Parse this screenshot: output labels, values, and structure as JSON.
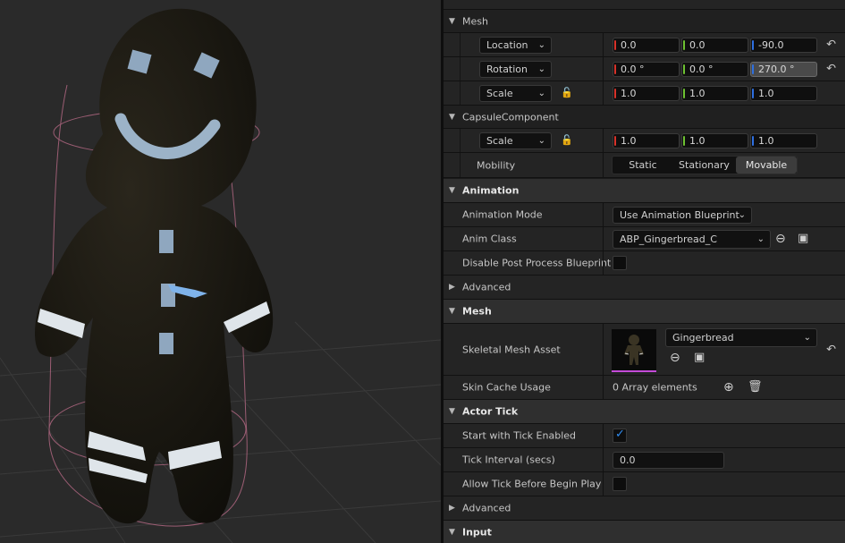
{
  "colors": {
    "x_axis": "#d8322a",
    "y_axis": "#6ec231",
    "z_axis": "#2d6fe0",
    "accent_checkbox": "#2f8cf0",
    "thumb_underline": "#c44bd8"
  },
  "details": {
    "mesh_group": "Mesh",
    "location": {
      "label": "Location",
      "x": "0.0",
      "y": "0.0",
      "z": "-90.0"
    },
    "rotation": {
      "label": "Rotation",
      "x": "0.0 °",
      "y": "0.0 °",
      "z": "270.0 °"
    },
    "scale": {
      "label": "Scale",
      "x": "1.0",
      "y": "1.0",
      "z": "1.0"
    },
    "capsule_group": "CapsuleComponent",
    "capsule_scale": {
      "label": "Scale",
      "x": "1.0",
      "y": "1.0",
      "z": "1.0"
    },
    "mobility": {
      "label": "Mobility",
      "options": [
        "Static",
        "Stationary",
        "Movable"
      ],
      "selected": "Movable"
    }
  },
  "animation": {
    "title": "Animation",
    "mode_label": "Animation Mode",
    "mode_value": "Use Animation Blueprint",
    "class_label": "Anim Class",
    "class_value": "ABP_Gingerbread_C",
    "disable_pp_label": "Disable Post Process Blueprint",
    "disable_pp_checked": false,
    "advanced_label": "Advanced"
  },
  "mesh_section": {
    "title": "Mesh",
    "asset_label": "Skeletal Mesh Asset",
    "asset_value": "Gingerbread",
    "skin_cache_label": "Skin Cache Usage",
    "skin_cache_value": "0 Array elements"
  },
  "actor_tick": {
    "title": "Actor Tick",
    "start_label": "Start with Tick Enabled",
    "start_checked": true,
    "interval_label": "Tick Interval (secs)",
    "interval_value": "0.0",
    "allow_label": "Allow Tick Before Begin Play",
    "allow_checked": false,
    "advanced_label": "Advanced"
  },
  "input_section": {
    "title": "Input"
  },
  "icons": {
    "expanded": "triangle-down-icon",
    "collapsed": "triangle-right-icon",
    "reset": "reset-arrow-icon",
    "lock": "lock-icon",
    "dropdown": "chevron-down-icon",
    "use_selected": "use-selected-icon",
    "browse": "browse-asset-icon",
    "add": "add-icon",
    "delete": "trash-icon",
    "check": "checkmark-icon"
  }
}
